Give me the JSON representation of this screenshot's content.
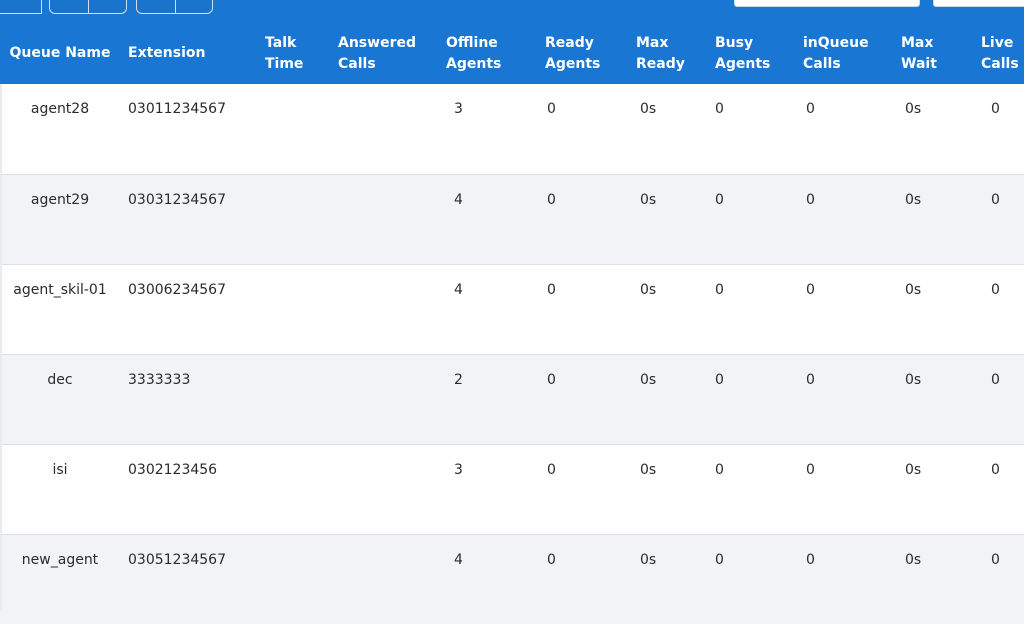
{
  "toolbar": {
    "buttons": [
      {
        "name": "first-button",
        "icon": "arrow-icon"
      },
      {
        "name": "queue-button",
        "icon": "queue-icon"
      },
      {
        "name": "second-button",
        "icon": "number-icon"
      },
      {
        "name": "alert-button",
        "icon": "heart-icon"
      },
      {
        "name": "third-button",
        "icon": "number-icon"
      }
    ],
    "search_placeholder": "",
    "filter_placeholder": ""
  },
  "colors": {
    "header_bg": "#1976d2",
    "row_alt_bg": "#f2f3f7",
    "text": "#2b2b2b"
  },
  "table": {
    "columns": [
      "Queue Name",
      "Extension",
      "Talk\nTime",
      "Answered\nCalls",
      "Offline\nAgents",
      "Ready\nAgents",
      "Max\nReady",
      "Busy\nAgents",
      "inQueue\nCalls",
      "Max\nWait",
      "Live\nCalls"
    ],
    "rows": [
      {
        "queue_name": "agent28",
        "extension": "03011234567",
        "talk_time": "",
        "answered_calls": "",
        "offline_agents": "3",
        "ready_agents": "0",
        "max_ready": "0s",
        "busy_agents": "0",
        "inqueue_calls": "0",
        "max_wait": "0s",
        "live_calls": "0"
      },
      {
        "queue_name": "agent29",
        "extension": "03031234567",
        "talk_time": "",
        "answered_calls": "",
        "offline_agents": "4",
        "ready_agents": "0",
        "max_ready": "0s",
        "busy_agents": "0",
        "inqueue_calls": "0",
        "max_wait": "0s",
        "live_calls": "0"
      },
      {
        "queue_name": "agent_skil-01",
        "extension": "03006234567",
        "talk_time": "",
        "answered_calls": "",
        "offline_agents": "4",
        "ready_agents": "0",
        "max_ready": "0s",
        "busy_agents": "0",
        "inqueue_calls": "0",
        "max_wait": "0s",
        "live_calls": "0"
      },
      {
        "queue_name": "dec",
        "extension": "3333333",
        "talk_time": "",
        "answered_calls": "",
        "offline_agents": "2",
        "ready_agents": "0",
        "max_ready": "0s",
        "busy_agents": "0",
        "inqueue_calls": "0",
        "max_wait": "0s",
        "live_calls": "0"
      },
      {
        "queue_name": "isi",
        "extension": "0302123456",
        "talk_time": "",
        "answered_calls": "",
        "offline_agents": "3",
        "ready_agents": "0",
        "max_ready": "0s",
        "busy_agents": "0",
        "inqueue_calls": "0",
        "max_wait": "0s",
        "live_calls": "0"
      },
      {
        "queue_name": "new_agent",
        "extension": "03051234567",
        "talk_time": "",
        "answered_calls": "",
        "offline_agents": "4",
        "ready_agents": "0",
        "max_ready": "0s",
        "busy_agents": "0",
        "inqueue_calls": "0",
        "max_wait": "0s",
        "live_calls": "0"
      }
    ]
  }
}
